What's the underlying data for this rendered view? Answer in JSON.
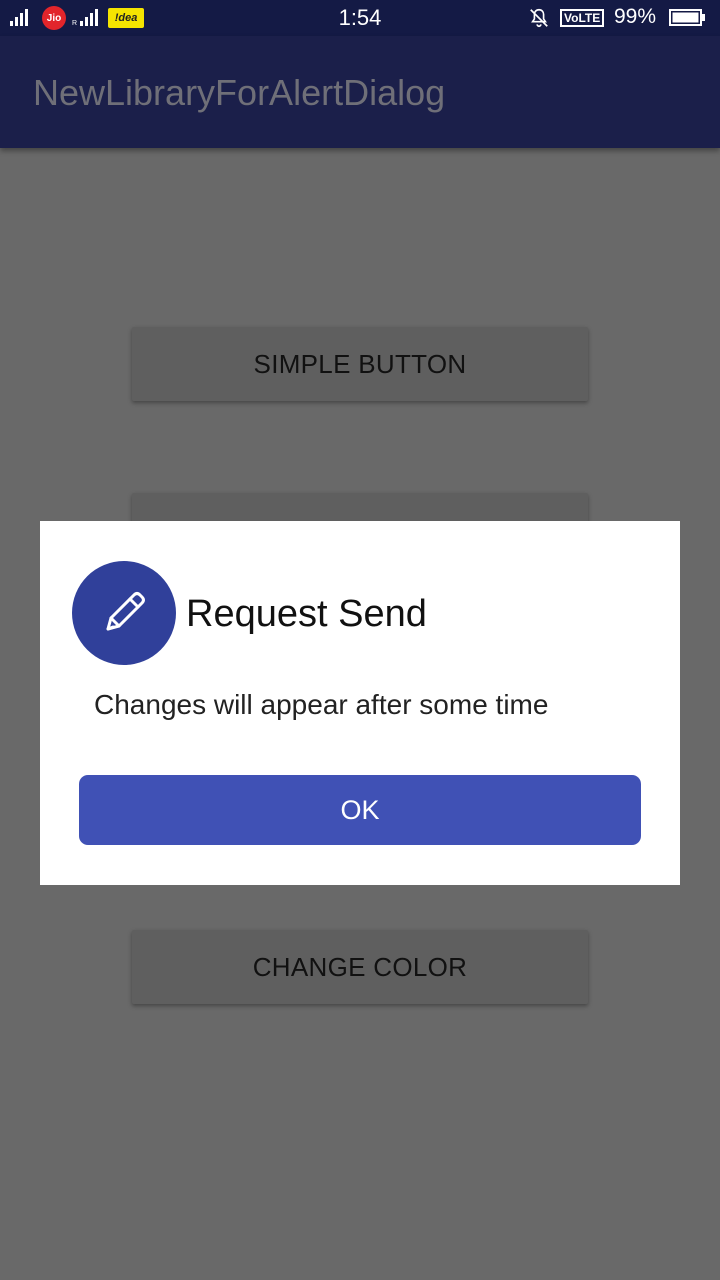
{
  "status_bar": {
    "carrier1": "Jio",
    "roaming": "R",
    "carrier2": "!dea",
    "time": "1:54",
    "volte": "VoLTE",
    "battery": "99%",
    "icons": [
      "signal-icon",
      "mute-icon",
      "battery-icon"
    ]
  },
  "app_bar": {
    "title": "NewLibraryForAlertDialog"
  },
  "background": {
    "buttons": [
      {
        "label": "SIMPLE BUTTON"
      },
      {
        "label": ""
      },
      {
        "label": "CHANGE COLOR"
      }
    ]
  },
  "dialog": {
    "icon": "pencil-icon",
    "title": "Request Send",
    "message": "Changes will appear after some time",
    "ok_label": "OK"
  },
  "colors": {
    "app_bar": "#1b1f4a",
    "status_bar": "#141a45",
    "overlay": "#696969",
    "dialog_icon_bg": "#30409a",
    "ok_button": "#4051b5"
  }
}
